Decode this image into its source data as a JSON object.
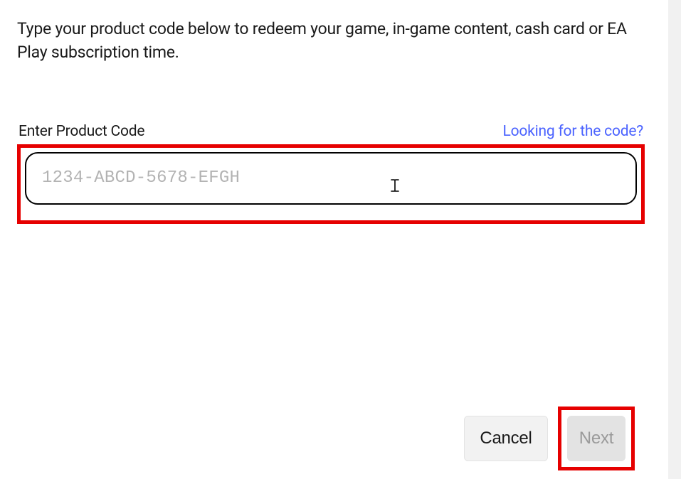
{
  "intro": "Type your product code below to redeem your game, in-game content, cash card or EA Play subscription time.",
  "field": {
    "label": "Enter Product Code",
    "help_link": "Looking for the code?",
    "placeholder": "1234-ABCD-5678-EFGH",
    "value": ""
  },
  "buttons": {
    "cancel": "Cancel",
    "next": "Next"
  }
}
